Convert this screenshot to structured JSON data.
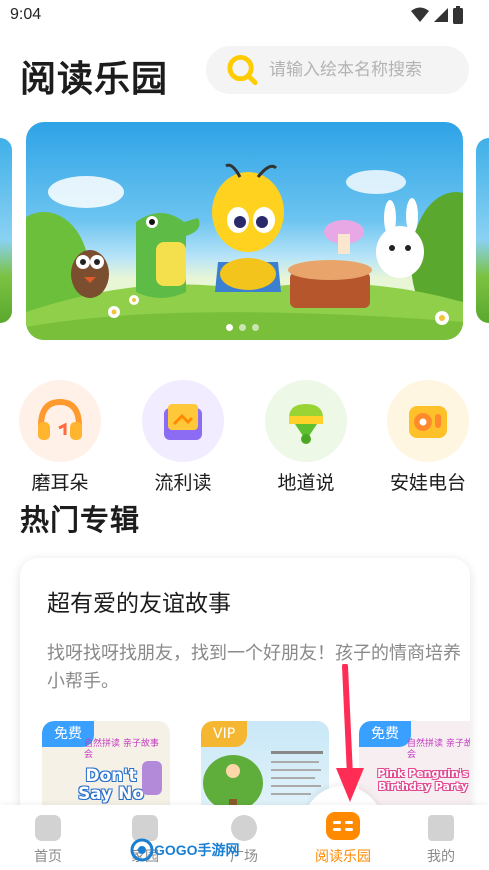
{
  "status_bar": {
    "time": "9:04"
  },
  "header": {
    "title": "阅读乐园",
    "search_placeholder": "请输入绘本名称搜索"
  },
  "carousel": {
    "page_count": 3,
    "active_index": 0
  },
  "categories": [
    {
      "label": "磨耳朵",
      "icon": "headphones-icon",
      "bg": "#fff1e8"
    },
    {
      "label": "流利读",
      "icon": "book-icon",
      "bg": "#f1ecff"
    },
    {
      "label": "地道说",
      "icon": "microphone-icon",
      "bg": "#eef8e6"
    },
    {
      "label": "安娃电台",
      "icon": "radio-icon",
      "bg": "#fff6e2"
    }
  ],
  "section": {
    "title": "热门专辑"
  },
  "album": {
    "title": "超有爱的友谊故事",
    "description": "找呀找呀找朋友，找到一个好朋友！孩子的情商培养小帮手。",
    "books": [
      {
        "tag": "免费",
        "tag_color": "#3aa0ff",
        "cover_text": "Don't Say No",
        "series": "自然拼读 亲子故事会"
      },
      {
        "tag": "VIP",
        "tag_color": "#f5b731",
        "cover_text": "",
        "series": ""
      },
      {
        "tag": "免费",
        "tag_color": "#3aa0ff",
        "cover_text": "Pink Penguin's Birthday Party",
        "series": "自然拼读 亲子故事会"
      }
    ]
  },
  "tabbar": [
    {
      "label": "首页",
      "icon": "home-icon",
      "active": false
    },
    {
      "label": "家园",
      "icon": "video-icon",
      "active": false
    },
    {
      "label": "广场",
      "icon": "planet-icon",
      "active": false
    },
    {
      "label": "阅读乐园",
      "icon": "reading-icon",
      "active": true
    },
    {
      "label": "我的",
      "icon": "graduation-cap-icon",
      "active": false
    }
  ],
  "watermark": {
    "text": "GOGO手游网"
  },
  "colors": {
    "accent": "#ff8a00",
    "annotation_arrow": "#ff2d55"
  }
}
